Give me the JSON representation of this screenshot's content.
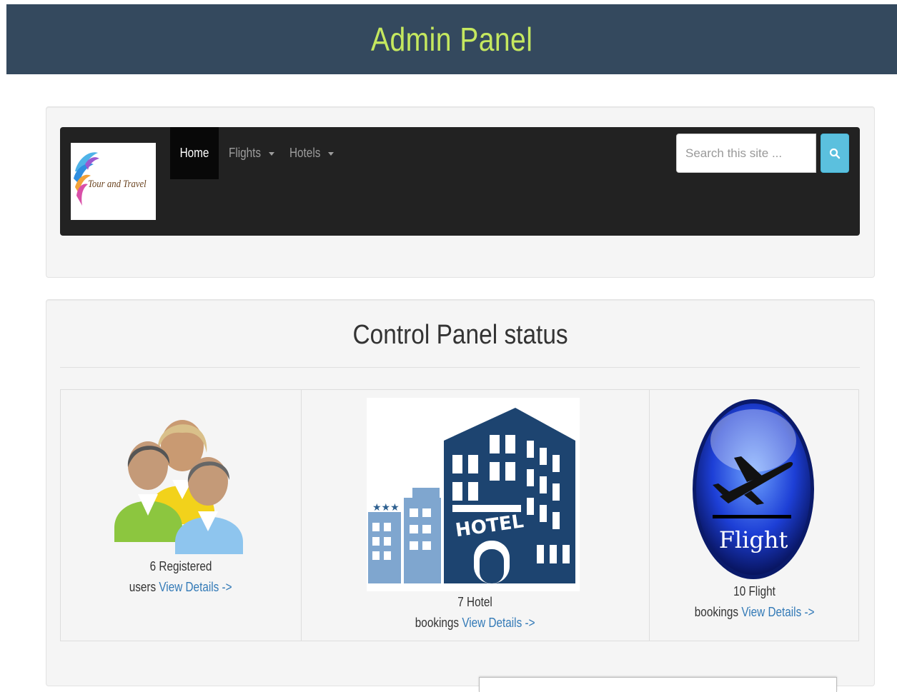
{
  "header": {
    "title": "Admin Panel"
  },
  "navbar": {
    "logo_text": "Tour and Travel",
    "items": [
      {
        "label": "Home",
        "active": true
      },
      {
        "label": "Flights",
        "dropdown": true
      },
      {
        "label": "Hotels",
        "dropdown": true
      }
    ],
    "search": {
      "placeholder": "Search this site ...",
      "button_icon": "search-icon"
    }
  },
  "status": {
    "title": "Control Panel status",
    "cards": [
      {
        "icon": "users-icon",
        "count_text": "6 Registered",
        "noun": "users",
        "link": "View Details ->"
      },
      {
        "icon": "hotel-icon",
        "count_text": "7 Hotel",
        "noun": "bookings",
        "link": "View Details ->",
        "image_text": "HOTEL"
      },
      {
        "icon": "flight-icon",
        "count_text": "10 Flight",
        "noun": "bookings",
        "link": "View Details ->",
        "image_text": "Flight"
      }
    ]
  },
  "colors": {
    "header_bg": "#34495e",
    "header_title": "#c5e85f",
    "navbar_bg": "#222222",
    "link": "#337ab7",
    "search_button": "#5bc0de"
  }
}
